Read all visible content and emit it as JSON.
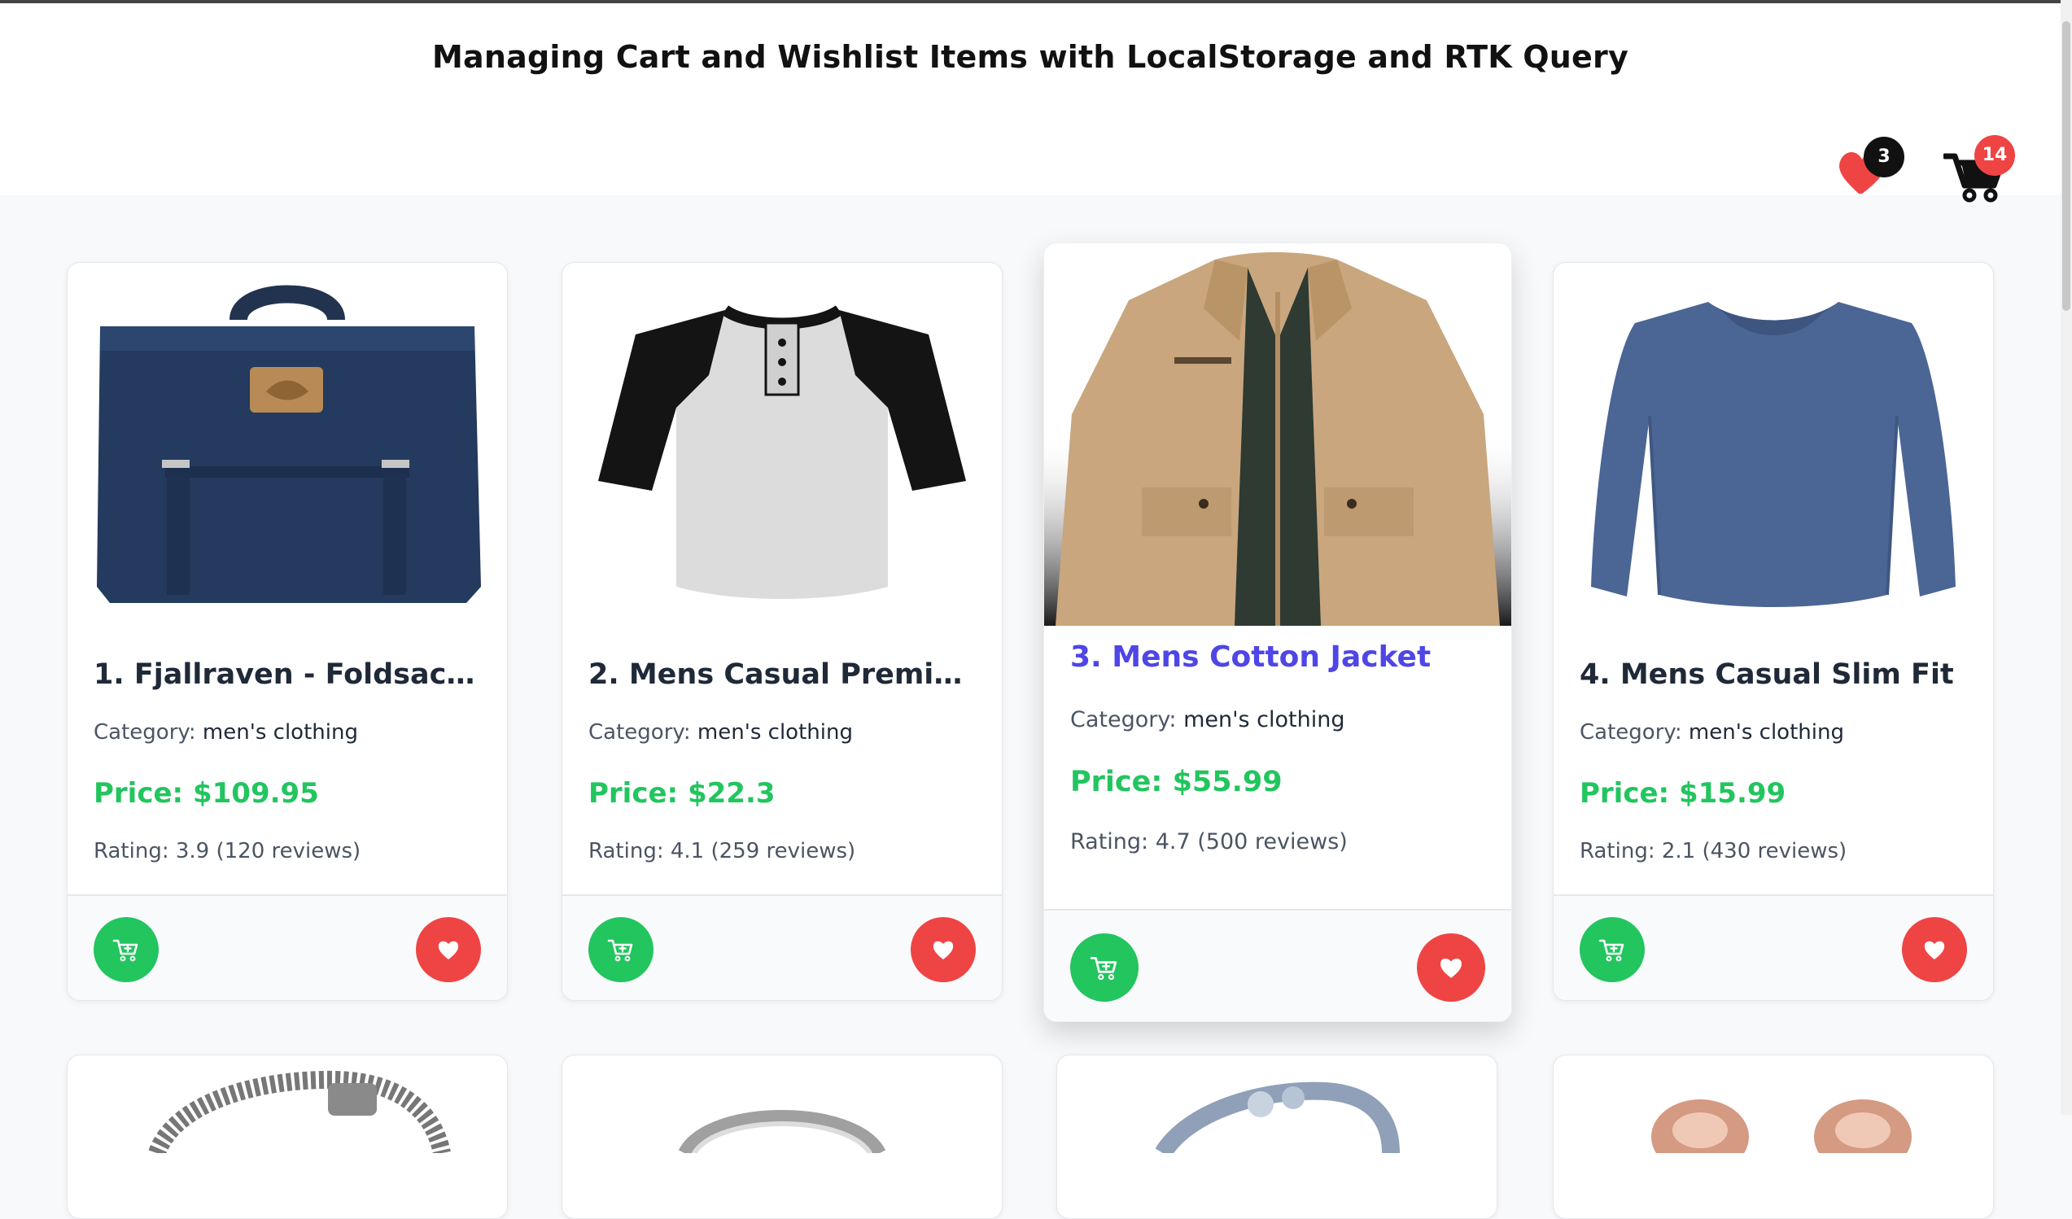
{
  "header": {
    "title": "Managing Cart and Wishlist Items with LocalStorage and RTK Query",
    "wishlist_count": "3",
    "cart_count": "14"
  },
  "labels": {
    "category": "Category:",
    "price_prefix": "Price: $"
  },
  "colors": {
    "accent": "#4f46e5",
    "price": "#22c55e",
    "wishlist": "#ef4444",
    "cart": "#22c55e"
  },
  "products": [
    {
      "title": "1. Fjallraven - Foldsack No...",
      "category": "men's clothing",
      "price": "Price: $109.95",
      "rating": "Rating: 3.9 (120 reviews)",
      "image": "backpack"
    },
    {
      "title": "2. Mens Casual Premium S...",
      "category": "men's clothing",
      "price": "Price: $22.3",
      "rating": "Rating: 4.1 (259 reviews)",
      "image": "raglan-tshirt"
    },
    {
      "title": "3. Mens Cotton Jacket",
      "category": "men's clothing",
      "price": "Price: $55.99",
      "rating": "Rating: 4.7 (500 reviews)",
      "image": "jacket"
    },
    {
      "title": "4. Mens Casual Slim Fit",
      "category": "men's clothing",
      "price": "Price: $15.99",
      "rating": "Rating: 2.1 (430 reviews)",
      "image": "long-sleeve-shirt"
    }
  ],
  "icons": {
    "wishlist": "heart-icon",
    "cart": "cart-icon",
    "add_to_cart": "cart-plus-icon",
    "add_to_wishlist": "heart-icon"
  }
}
